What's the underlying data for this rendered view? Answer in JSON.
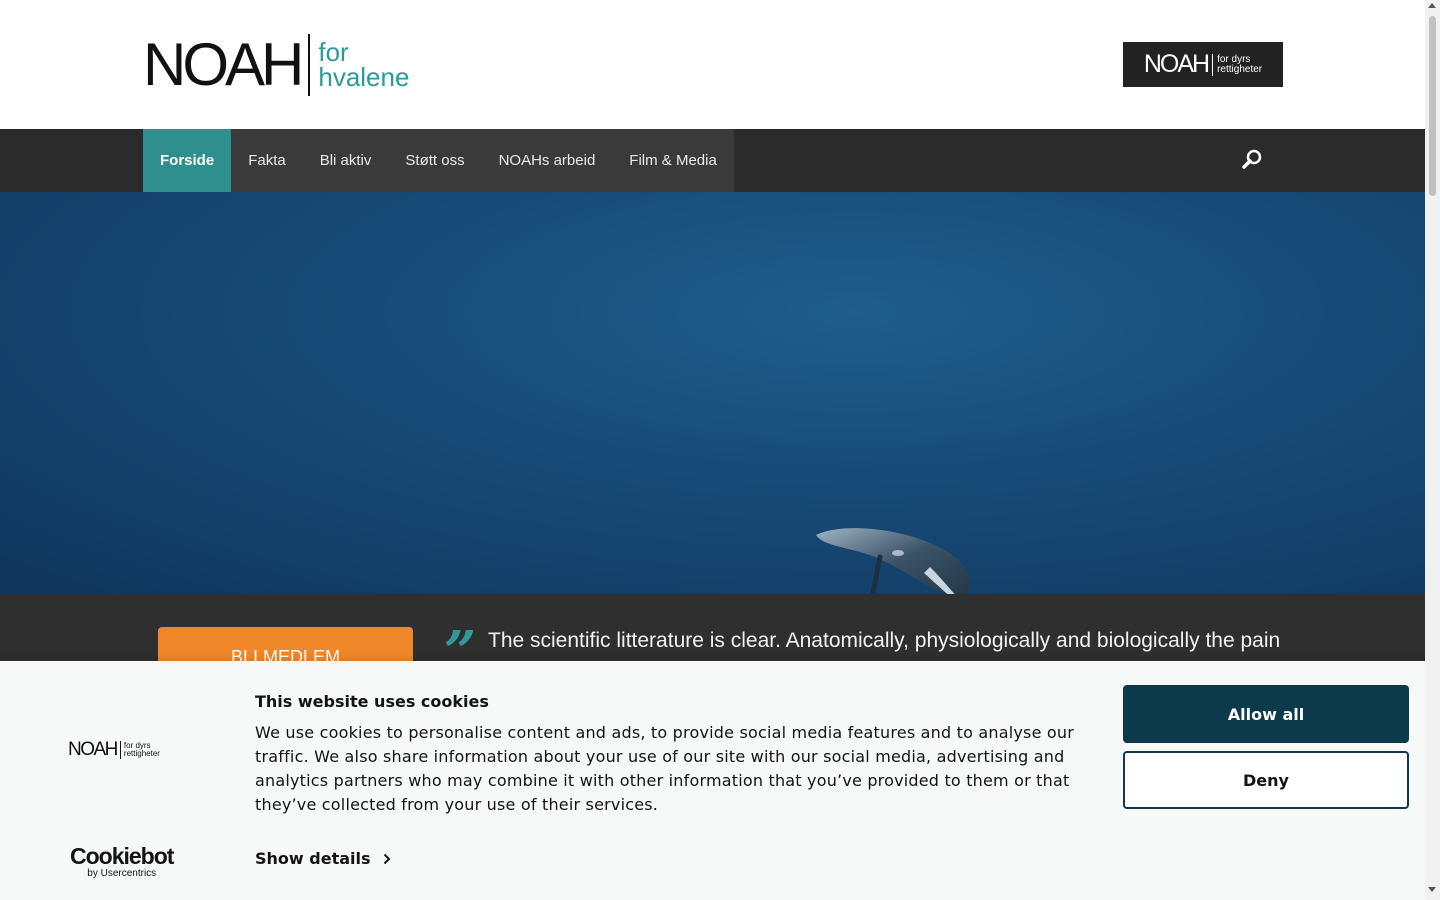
{
  "header": {
    "logo": {
      "main": "NOAH",
      "sub_line1": "for",
      "sub_line2": "hvalene"
    },
    "partner_logo": {
      "main": "NOAH",
      "sub_line1": "for dyrs",
      "sub_line2": "rettigheter"
    }
  },
  "nav": {
    "items": [
      {
        "label": "Forside",
        "active": true
      },
      {
        "label": "Fakta"
      },
      {
        "label": "Bli aktiv"
      },
      {
        "label": "Støtt oss"
      },
      {
        "label": "NOAHs arbeid"
      },
      {
        "label": "Film & Media"
      }
    ],
    "search_icon": "search-icon"
  },
  "hero": {
    "image": "underwater-whale-photo"
  },
  "strip": {
    "join_button": "BLI MEDLEM",
    "quote_mark": "”",
    "quote": "The scientific litterature is clear. Anatomically, physiologically and biologically the pain"
  },
  "cookie": {
    "logo": {
      "main": "NOAH",
      "sub_line1": "for dyrs",
      "sub_line2": "rettigheter"
    },
    "title": "This website uses cookies",
    "text": "We use cookies to personalise content and ads, to provide social media features and to analyse our traffic. We also share information about your use of our site with our social media, advertising and analytics partners who may combine it with other information that you’ve provided to them or that they’ve collected from your use of their services.",
    "show_details": "Show details",
    "allow_all": "Allow all",
    "deny": "Deny",
    "cookiebot": {
      "main": "Cookiebot",
      "sub": "by Usercentrics"
    }
  },
  "colors": {
    "accent_teal": "#2f8f8f",
    "nav_bg": "#2b2b2b",
    "join_orange": "#f0882a",
    "cookie_primary": "#0d3a4a"
  }
}
